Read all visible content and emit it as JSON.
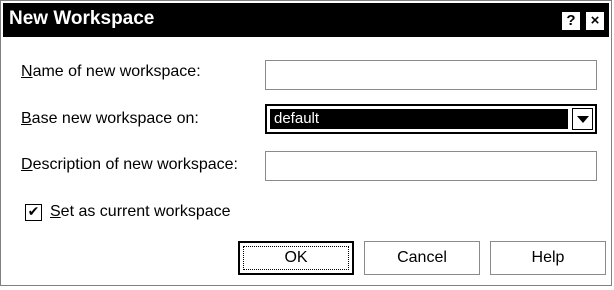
{
  "window": {
    "title": "New Workspace",
    "help_button": "?",
    "close_button": "×"
  },
  "form": {
    "name_label_key": "N",
    "name_label_rest": "ame of new workspace:",
    "name_value": "",
    "base_label_key": "B",
    "base_label_rest": "ase new workspace on:",
    "base_selected": "default",
    "description_label_key": "D",
    "description_label_rest": "escription of new workspace:",
    "description_value": "",
    "set_current_key": "S",
    "set_current_rest": "et as current workspace",
    "set_current_checked": "✔"
  },
  "buttons": {
    "ok": "OK",
    "cancel": "Cancel",
    "help": "Help"
  },
  "colors": {
    "titlebar": "#000000",
    "selection": "#000000",
    "background": "#ffffff"
  }
}
